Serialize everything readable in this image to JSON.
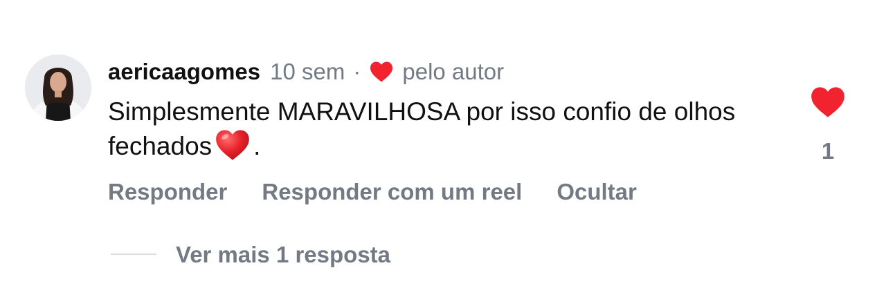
{
  "comment": {
    "username": "aericaagomes",
    "time": "10 sem",
    "separator": "·",
    "liked_by_author_label": "pelo autor",
    "text_main": "Simplesmente MARAVILHOSA por isso confio de olhos fechados",
    "text_end": ".",
    "emoji": "heart-emoji"
  },
  "actions": {
    "reply": "Responder",
    "reply_with_reel": "Responder com um reel",
    "hide": "Ocultar"
  },
  "like": {
    "count": "1",
    "liked": true,
    "icon": "heart-icon"
  },
  "replies": {
    "view_more": "Ver mais 1 resposta"
  },
  "colors": {
    "heart": "#f0232e",
    "secondary_text": "#737a83",
    "primary_text": "#111111"
  }
}
